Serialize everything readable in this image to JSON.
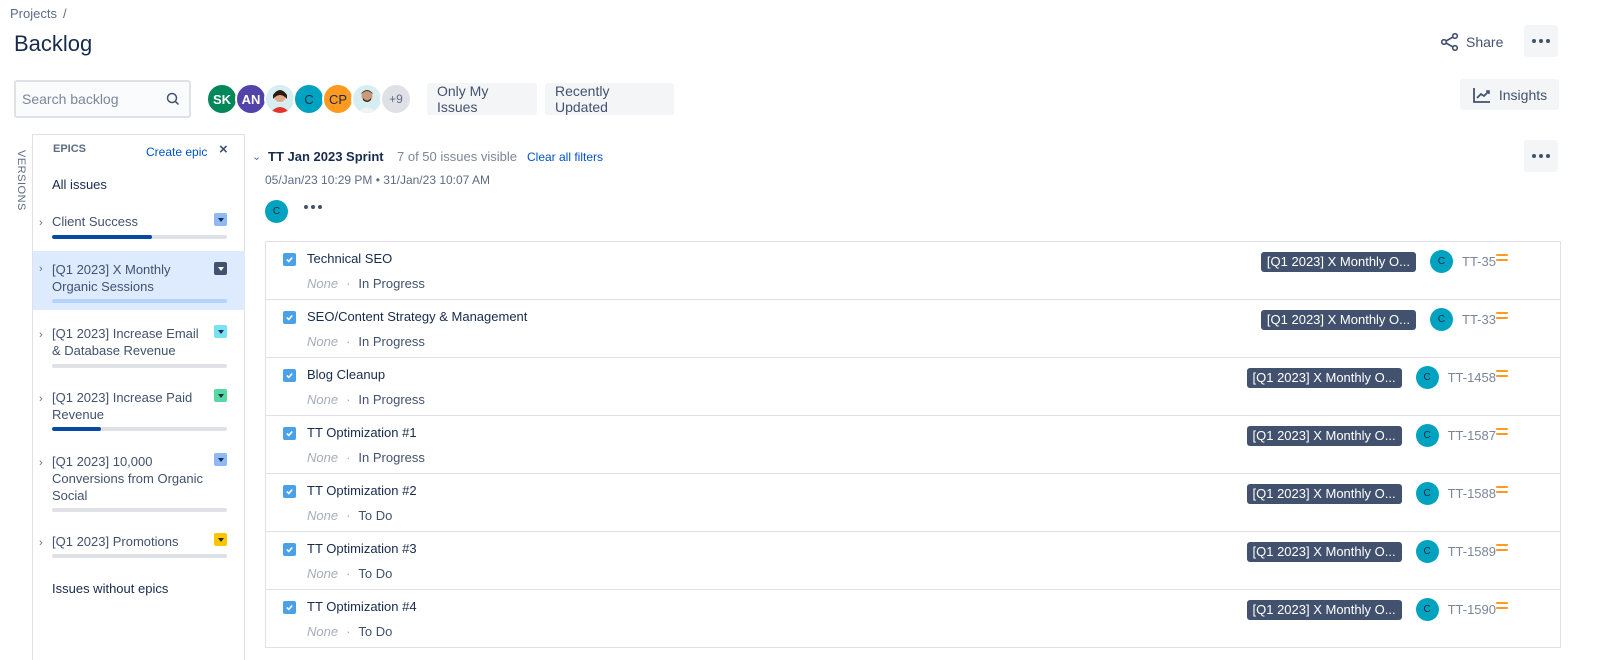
{
  "breadcrumb": {
    "items": [
      "Projects"
    ],
    "separator": "/"
  },
  "page_title": "Backlog",
  "header": {
    "share_label": "Share",
    "insights_label": "Insights"
  },
  "search": {
    "placeholder": "Search backlog",
    "value": ""
  },
  "avatars": [
    {
      "initials": "SK",
      "color": "#00875a",
      "type": "initials"
    },
    {
      "initials": "AN",
      "color": "#5243aa",
      "type": "initials"
    },
    {
      "initials": "",
      "color": "#d6eef2",
      "type": "photo"
    },
    {
      "initials": "C",
      "color": "#00a3bf",
      "type": "initials"
    },
    {
      "initials": "CP",
      "color": "#ff991f",
      "type": "initials"
    },
    {
      "initials": "",
      "color": "#d6eef2",
      "type": "photo"
    },
    {
      "initials": "+9",
      "color": "#dfe1e6",
      "type": "more"
    }
  ],
  "filters": {
    "only_my_issues": "Only My Issues",
    "recently_updated": "Recently Updated"
  },
  "versions_tab": "VERSIONS",
  "epics_panel": {
    "title": "EPICS",
    "create_label": "Create epic",
    "close_label": "×",
    "all_issues": "All issues",
    "issues_without_epics": "Issues without epics",
    "items": [
      {
        "name": "Client Success",
        "color": "#8fb8f6",
        "progress": 0.57,
        "selected": false
      },
      {
        "name": "[Q1 2023] X Monthly Organic Sessions",
        "color": "#42526e",
        "progress": 0,
        "selected": true
      },
      {
        "name": "[Q1 2023] Increase Email & Database Revenue",
        "color": "#79e2f2",
        "progress": 0,
        "selected": false
      },
      {
        "name": "[Q1 2023] Increase Paid Revenue",
        "color": "#57d9a3",
        "progress": 0.28,
        "selected": false
      },
      {
        "name": "[Q1 2023] 10,000 Conversions from Organic Social",
        "color": "#8fb8f6",
        "progress": 0,
        "selected": false
      },
      {
        "name": "[Q1 2023] Promotions",
        "color": "#ffc400",
        "progress": 0,
        "selected": false
      }
    ]
  },
  "sprint": {
    "name": "TT Jan 2023 Sprint",
    "count_text": "7 of 50 issues visible",
    "clear_filters": "Clear all filters",
    "dates": "05/Jan/23 10:29 PM • 31/Jan/23 10:07 AM",
    "assignee_initial": "C",
    "issues": [
      {
        "summary": "Technical SEO",
        "version": "None",
        "status": "In Progress",
        "epic": "[Q1 2023] X Monthly O...",
        "assignee": "C",
        "key": "TT-35",
        "priority": "medium"
      },
      {
        "summary": "SEO/Content Strategy & Management",
        "version": "None",
        "status": "In Progress",
        "epic": "[Q1 2023] X Monthly O...",
        "assignee": "C",
        "key": "TT-33",
        "priority": "medium"
      },
      {
        "summary": "Blog Cleanup",
        "version": "None",
        "status": "In Progress",
        "epic": "[Q1 2023] X Monthly O...",
        "assignee": "C",
        "key": "TT-1458",
        "priority": "medium"
      },
      {
        "summary": "TT Optimization #1",
        "version": "None",
        "status": "In Progress",
        "epic": "[Q1 2023] X Monthly O...",
        "assignee": "C",
        "key": "TT-1587",
        "priority": "medium"
      },
      {
        "summary": "TT Optimization #2",
        "version": "None",
        "status": "To Do",
        "epic": "[Q1 2023] X Monthly O...",
        "assignee": "C",
        "key": "TT-1588",
        "priority": "medium"
      },
      {
        "summary": "TT Optimization #3",
        "version": "None",
        "status": "To Do",
        "epic": "[Q1 2023] X Monthly O...",
        "assignee": "C",
        "key": "TT-1589",
        "priority": "medium"
      },
      {
        "summary": "TT Optimization #4",
        "version": "None",
        "status": "To Do",
        "epic": "[Q1 2023] X Monthly O...",
        "assignee": "C",
        "key": "TT-1590",
        "priority": "medium"
      }
    ]
  }
}
